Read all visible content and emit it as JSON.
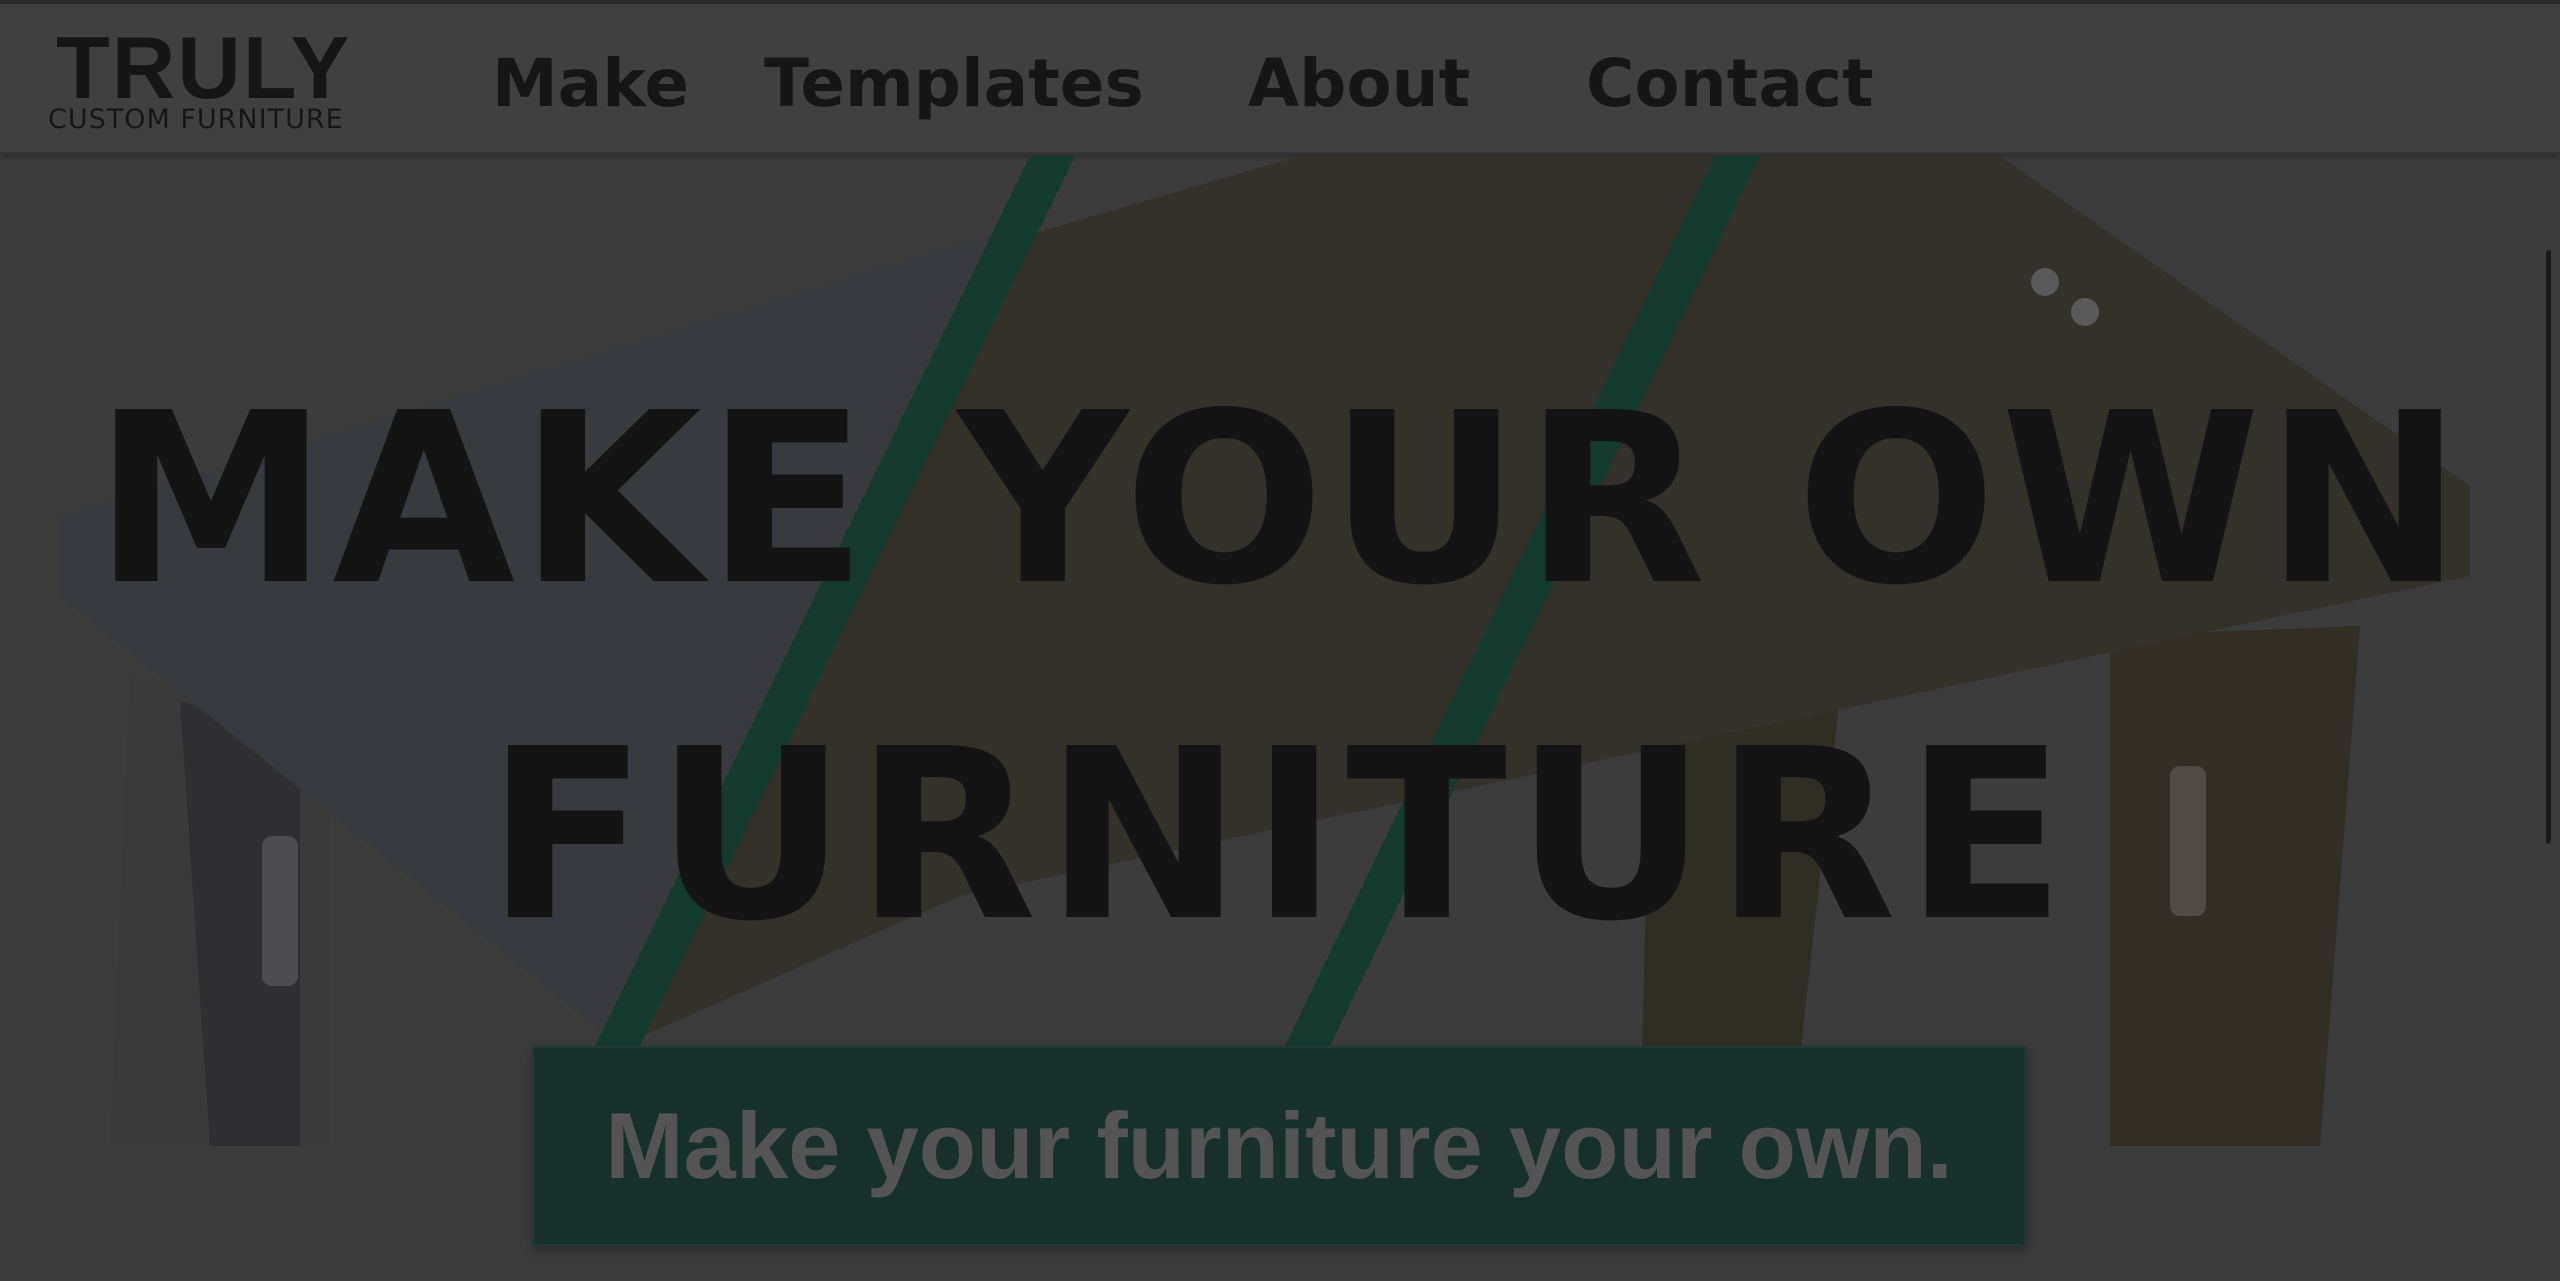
{
  "logo": {
    "main": "TRULY",
    "sub": "CUSTOM  FURNITURE"
  },
  "nav": {
    "items": [
      {
        "label": "Make"
      },
      {
        "label": "Templates"
      },
      {
        "label": "About"
      },
      {
        "label": "Contact"
      }
    ]
  },
  "hero": {
    "headline_line1": "MAKE YOUR OWN",
    "headline_line2": "FURNITURE",
    "cta_text": "Make your furniture your own.",
    "image": "plywood-table-illustration"
  },
  "colors": {
    "overlay_background": "#3c3c3c",
    "navbar": "#404040",
    "accent_green": "#17302a",
    "stripe_green": "#143a2e",
    "headline_text": "#141414"
  }
}
